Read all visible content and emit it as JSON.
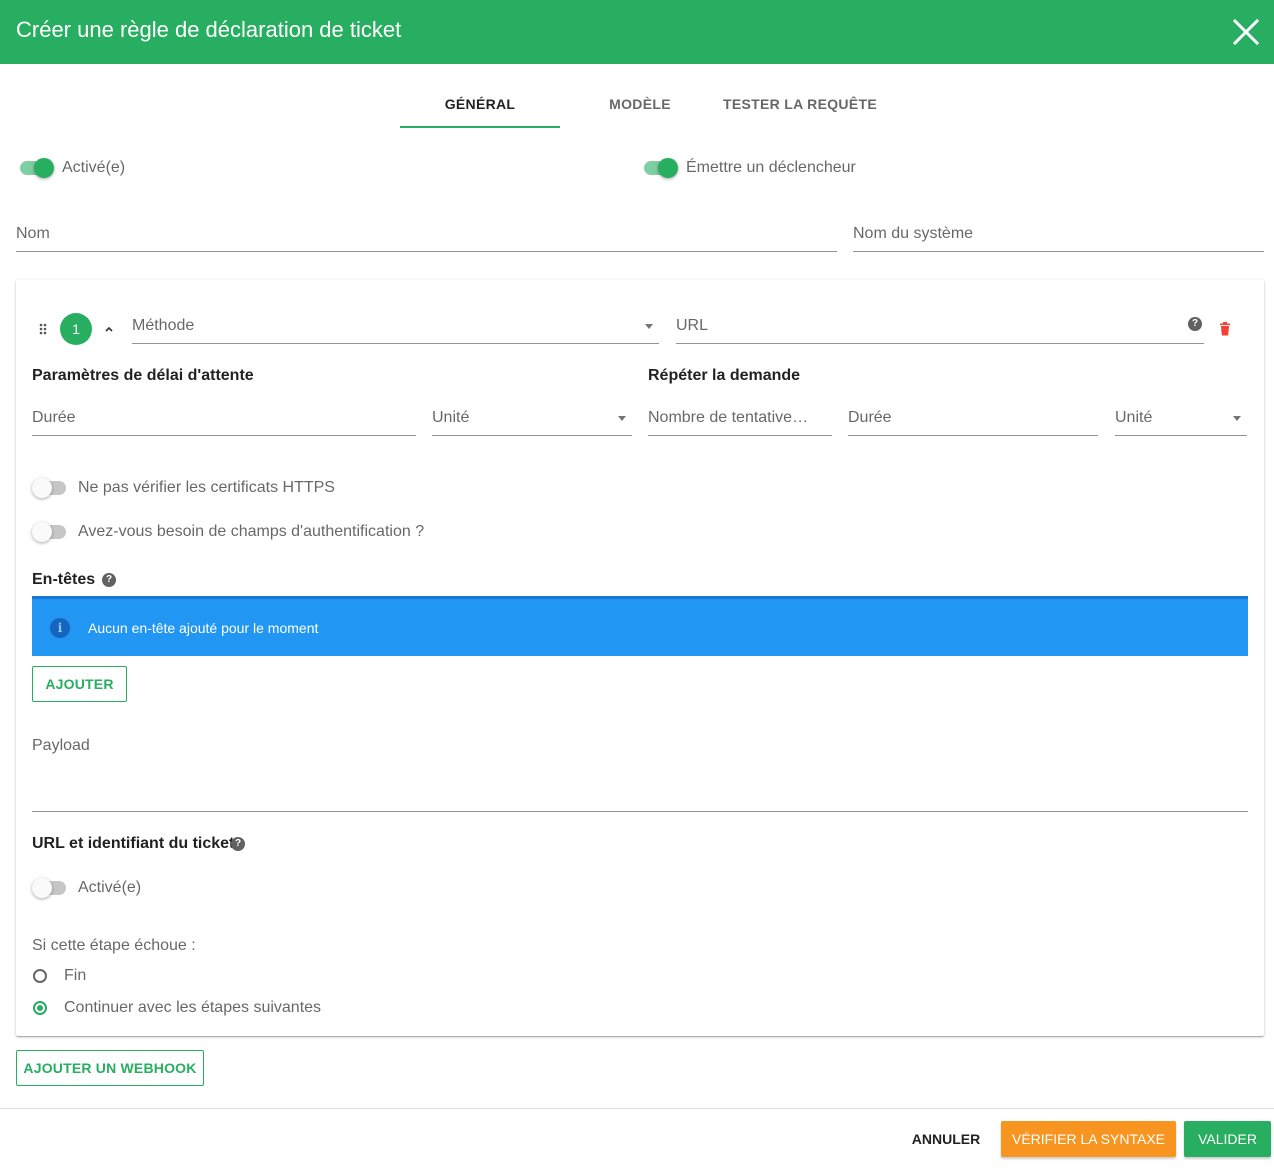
{
  "dialog": {
    "title": "Créer une règle de déclaration de ticket",
    "close_icon": "close-icon"
  },
  "tabs": [
    {
      "label": "GÉNÉRAL",
      "active": true
    },
    {
      "label": "MODÈLE",
      "active": false
    },
    {
      "label": "TESTER LA REQUÊTE",
      "active": false
    }
  ],
  "general": {
    "enabled": {
      "label": "Activé(e)",
      "checked": true
    },
    "emit_trigger": {
      "label": "Émettre un déclencheur",
      "checked": true
    },
    "name_field": {
      "label": "Nom",
      "value": ""
    },
    "system_name_field": {
      "label": "Nom du système",
      "value": ""
    }
  },
  "step": {
    "number": "1",
    "method_field": {
      "label": "Méthode",
      "value": ""
    },
    "url_field": {
      "label": "URL",
      "value": ""
    },
    "timeout": {
      "title": "Paramètres de délai d'attente",
      "duration_label": "Durée",
      "unit_label": "Unité"
    },
    "retry": {
      "title": "Répéter la demande",
      "attempts_label": "Nombre de tentatives de reprise",
      "duration_label": "Durée",
      "unit_label": "Unité"
    },
    "skip_https": {
      "label": "Ne pas vérifier les certificats HTTPS",
      "checked": false
    },
    "auth_fields": {
      "label": "Avez-vous besoin de champs d'authentification ?",
      "checked": false
    },
    "headers": {
      "title": "En-têtes",
      "empty_message": "Aucun en-tête ajouté pour le moment",
      "add_label": "AJOUTER"
    },
    "payload_label": "Payload",
    "ticket_url": {
      "title": "URL et identifiant du ticket",
      "enabled_label": "Activé(e)",
      "checked": false
    },
    "on_failure": {
      "label": "Si cette étape échoue :",
      "options": [
        {
          "label": "Fin",
          "selected": false
        },
        {
          "label": "Continuer avec les étapes suivantes",
          "selected": true
        }
      ]
    }
  },
  "add_webhook_label": "AJOUTER UN WEBHOOK",
  "footer": {
    "cancel_label": "ANNULER",
    "check_syntax_label": "VÉRIFIER LA SYNTAXE",
    "submit_label": "VALIDER"
  },
  "colors": {
    "primary": "#27ae60",
    "warning": "#f79520",
    "info": "#2196f3",
    "error": "#f44336"
  }
}
